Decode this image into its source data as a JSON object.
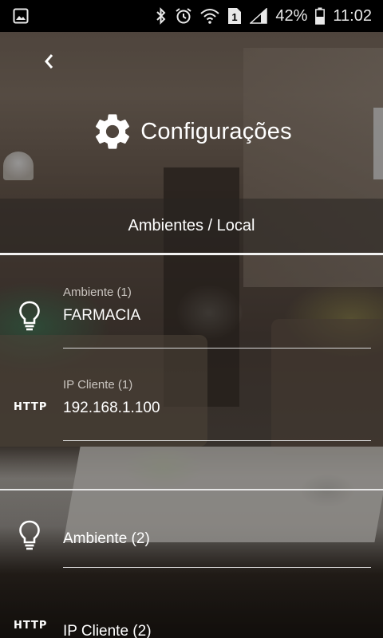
{
  "status_bar": {
    "battery_percent": "42%",
    "time": "11:02",
    "sim_slot": "1",
    "icons": [
      "gallery-notification-icon",
      "bluetooth-icon",
      "alarm-icon",
      "wifi-icon",
      "sim-icon",
      "signal-icon",
      "battery-icon"
    ]
  },
  "header": {
    "back_icon": "chevron-left-icon",
    "settings_icon": "gear-icon",
    "title": "Configurações"
  },
  "section": {
    "title": "Ambientes / Local"
  },
  "entries": [
    {
      "environment_label": "Ambiente (1)",
      "environment_value": "FARMACIA",
      "ip_label": "IP Cliente (1)",
      "ip_value": "192.168.1.100",
      "environment_icon": "lightbulb-icon",
      "ip_icon_text": "HTTP"
    },
    {
      "environment_placeholder": "Ambiente (2)",
      "ip_placeholder": "IP Cliente (2)",
      "environment_icon": "lightbulb-icon",
      "ip_icon_text": "HTTP"
    }
  ]
}
